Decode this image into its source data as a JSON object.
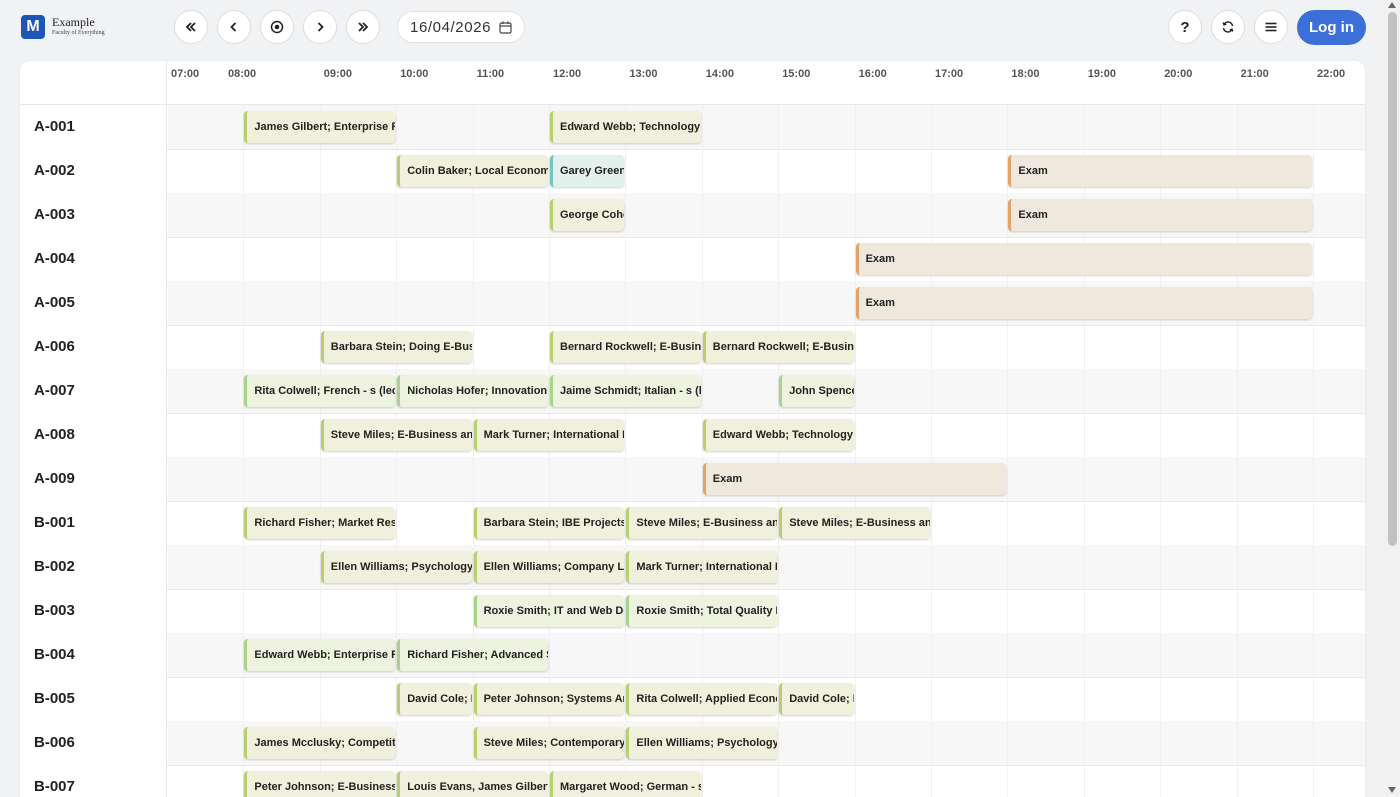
{
  "brand": {
    "logo_letter": "M",
    "name": "Example",
    "tagline": "Faculty of Everything"
  },
  "toolbar": {
    "first_icon": "double-chevron-left-icon",
    "prev_icon": "chevron-left-icon",
    "today_icon": "target-icon",
    "next_icon": "chevron-right-icon",
    "last_icon": "double-chevron-right-icon",
    "date": "16/04/2026",
    "help_label": "?",
    "login_label": "Log in"
  },
  "hours": [
    "07:00",
    "08:00",
    "09:00",
    "10:00",
    "11:00",
    "12:00",
    "13:00",
    "14:00",
    "15:00",
    "16:00",
    "17:00",
    "18:00",
    "19:00",
    "20:00",
    "21:00",
    "22:00"
  ],
  "rooms": [
    "A-001",
    "A-002",
    "A-003",
    "A-004",
    "A-005",
    "A-006",
    "A-007",
    "A-008",
    "A-009",
    "B-001",
    "B-002",
    "B-003",
    "B-004",
    "B-005",
    "B-006",
    "B-007"
  ],
  "events": [
    {
      "row": 0,
      "start": "08:00",
      "end": "10:00",
      "label": "James Gilbert; Enterprise Re",
      "kind": "lecture"
    },
    {
      "row": 0,
      "start": "12:00",
      "end": "14:00",
      "label": "Edward Webb; Technology",
      "kind": "lecture"
    },
    {
      "row": 1,
      "start": "10:00",
      "end": "12:00",
      "label": "Colin Baker; Local Economi",
      "kind": "lecture"
    },
    {
      "row": 1,
      "start": "12:00",
      "end": "13:00",
      "label": "Garey Green",
      "kind": "seminar"
    },
    {
      "row": 1,
      "start": "18:00",
      "end": "22:00",
      "label": "Exam",
      "kind": "exam"
    },
    {
      "row": 2,
      "start": "12:00",
      "end": "13:00",
      "label": "George Cohe",
      "kind": "lecture"
    },
    {
      "row": 2,
      "start": "18:00",
      "end": "22:00",
      "label": "Exam",
      "kind": "exam"
    },
    {
      "row": 3,
      "start": "16:00",
      "end": "22:00",
      "label": "Exam",
      "kind": "exam"
    },
    {
      "row": 4,
      "start": "16:00",
      "end": "22:00",
      "label": "Exam",
      "kind": "exam"
    },
    {
      "row": 5,
      "start": "09:00",
      "end": "11:00",
      "label": "Barbara Stein; Doing E-Busi",
      "kind": "lecture"
    },
    {
      "row": 5,
      "start": "12:00",
      "end": "14:00",
      "label": "Bernard Rockwell; E-Busine",
      "kind": "lecture"
    },
    {
      "row": 5,
      "start": "14:00",
      "end": "16:00",
      "label": "Bernard Rockwell; E-Busine",
      "kind": "lecture"
    },
    {
      "row": 6,
      "start": "08:00",
      "end": "10:00",
      "label": "Rita Colwell; French - s (lec",
      "kind": "lab"
    },
    {
      "row": 6,
      "start": "10:00",
      "end": "12:00",
      "label": "Nicholas Hofer; Innovation",
      "kind": "lab"
    },
    {
      "row": 6,
      "start": "12:00",
      "end": "14:00",
      "label": "Jaime Schmidt; Italian - s (l",
      "kind": "lab"
    },
    {
      "row": 6,
      "start": "15:00",
      "end": "16:00",
      "label": "John Spence",
      "kind": "lab"
    },
    {
      "row": 7,
      "start": "09:00",
      "end": "11:00",
      "label": "Steve Miles; E-Business and",
      "kind": "lecture"
    },
    {
      "row": 7,
      "start": "11:00",
      "end": "13:00",
      "label": "Mark Turner; International F",
      "kind": "lecture"
    },
    {
      "row": 7,
      "start": "14:00",
      "end": "16:00",
      "label": "Edward Webb; Technology",
      "kind": "lecture"
    },
    {
      "row": 8,
      "start": "14:00",
      "end": "18:00",
      "label": "Exam",
      "kind": "exam"
    },
    {
      "row": 9,
      "start": "08:00",
      "end": "10:00",
      "label": "Richard Fisher; Market Rese",
      "kind": "lecture"
    },
    {
      "row": 9,
      "start": "11:00",
      "end": "13:00",
      "label": "Barbara Stein; IBE Projects",
      "kind": "lecture"
    },
    {
      "row": 9,
      "start": "13:00",
      "end": "15:00",
      "label": "Steve Miles; E-Business and",
      "kind": "lecture"
    },
    {
      "row": 9,
      "start": "15:00",
      "end": "17:00",
      "label": "Steve Miles; E-Business and",
      "kind": "lecture"
    },
    {
      "row": 10,
      "start": "09:00",
      "end": "11:00",
      "label": "Ellen Williams; Psychology",
      "kind": "lecture"
    },
    {
      "row": 10,
      "start": "11:00",
      "end": "13:00",
      "label": "Ellen Williams; Company La",
      "kind": "lecture"
    },
    {
      "row": 10,
      "start": "13:00",
      "end": "15:00",
      "label": "Mark Turner; International F",
      "kind": "lecture"
    },
    {
      "row": 11,
      "start": "11:00",
      "end": "13:00",
      "label": "Roxie Smith; IT and Web De",
      "kind": "lab"
    },
    {
      "row": 11,
      "start": "13:00",
      "end": "15:00",
      "label": "Roxie Smith; Total Quality M",
      "kind": "lab"
    },
    {
      "row": 12,
      "start": "08:00",
      "end": "10:00",
      "label": "Edward Webb; Enterprise Re",
      "kind": "lab"
    },
    {
      "row": 12,
      "start": "10:00",
      "end": "12:00",
      "label": "Richard Fisher; Advanced S",
      "kind": "lab"
    },
    {
      "row": 13,
      "start": "10:00",
      "end": "11:00",
      "label": "David Cole; P",
      "kind": "lecture"
    },
    {
      "row": 13,
      "start": "11:00",
      "end": "13:00",
      "label": "Peter Johnson; Systems An",
      "kind": "lecture"
    },
    {
      "row": 13,
      "start": "13:00",
      "end": "15:00",
      "label": "Rita Colwell; Applied Econo",
      "kind": "lecture"
    },
    {
      "row": 13,
      "start": "15:00",
      "end": "16:00",
      "label": "David Cole; P",
      "kind": "lecture"
    },
    {
      "row": 14,
      "start": "08:00",
      "end": "10:00",
      "label": "James Mcclusky; Competiti",
      "kind": "lecture"
    },
    {
      "row": 14,
      "start": "11:00",
      "end": "13:00",
      "label": "Steve Miles; Contemporary",
      "kind": "lecture"
    },
    {
      "row": 14,
      "start": "13:00",
      "end": "15:00",
      "label": "Ellen Williams; Psychology",
      "kind": "lecture"
    },
    {
      "row": 15,
      "start": "08:00",
      "end": "10:00",
      "label": "Peter Johnson; E-Business",
      "kind": "lecture"
    },
    {
      "row": 15,
      "start": "10:00",
      "end": "12:00",
      "label": "Louis Evans, James Gilbert;",
      "kind": "lecture"
    },
    {
      "row": 15,
      "start": "12:00",
      "end": "14:00",
      "label": "Margaret Wood; German - s",
      "kind": "lecture"
    }
  ]
}
